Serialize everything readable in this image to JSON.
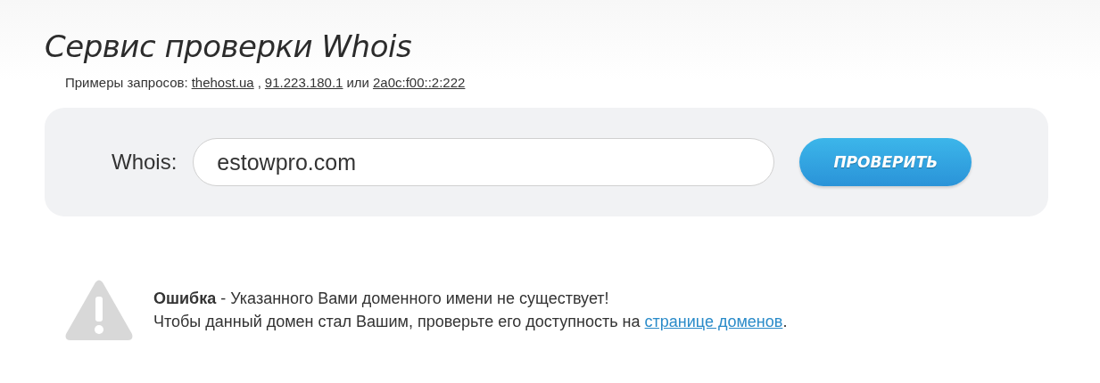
{
  "title": "Сервис проверки Whois",
  "examples": {
    "label": "Примеры запросов:",
    "links": [
      "thehost.ua",
      "91.223.180.1",
      "2a0c:f00::2:222"
    ],
    "separators": [
      ",",
      "или"
    ]
  },
  "form": {
    "label": "Whois:",
    "value": "estowpro.com",
    "button": "ПРОВЕРИТЬ"
  },
  "message": {
    "kind": "error",
    "line1": "**Ошибка** - Указанного Вами доменного имени не существует!",
    "line2_before": "Чтобы данный домен стал Вашим, проверьте его доступность на ",
    "link": "странице доменов",
    "line2_after": "."
  }
}
